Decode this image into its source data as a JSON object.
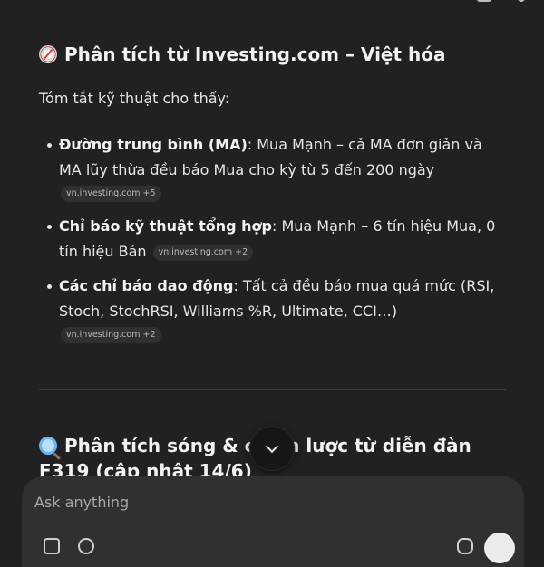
{
  "section1": {
    "title": "Phân tích từ Investing.com – Việt hóa",
    "intro": "Tóm tắt kỹ thuật cho thấy:",
    "points": [
      {
        "label": "Đường trung bình (MA)",
        "text": ": Mua Mạnh – cả MA đơn giản và MA lũy thừa đều báo Mua cho kỳ từ 5 đến 200 ngày",
        "source": "vn.investing.com +5"
      },
      {
        "label": "Chỉ báo kỹ thuật tổng hợp",
        "text": ": Mua Mạnh – 6 tín hiệu Mua, 0 tín hiệu Bán",
        "source": "vn.investing.com +2"
      },
      {
        "label": "Các chỉ báo dao động",
        "text": ": Tất cả đều báo mua quá mức (RSI, Stoch, StochRSI, Williams %R, Ultimate, CCI…)",
        "source": "vn.investing.com +2"
      }
    ]
  },
  "section2": {
    "title": "Phân tích sóng & chiến lược từ diễn đàn F319 (cập nhật 14/6)"
  },
  "composer": {
    "placeholder": "Ask anything"
  },
  "icons": {
    "section1_icon": "compass-icon",
    "section2_icon": "magnifying-glass-icon",
    "scroll_icon": "chevron-down-icon"
  }
}
